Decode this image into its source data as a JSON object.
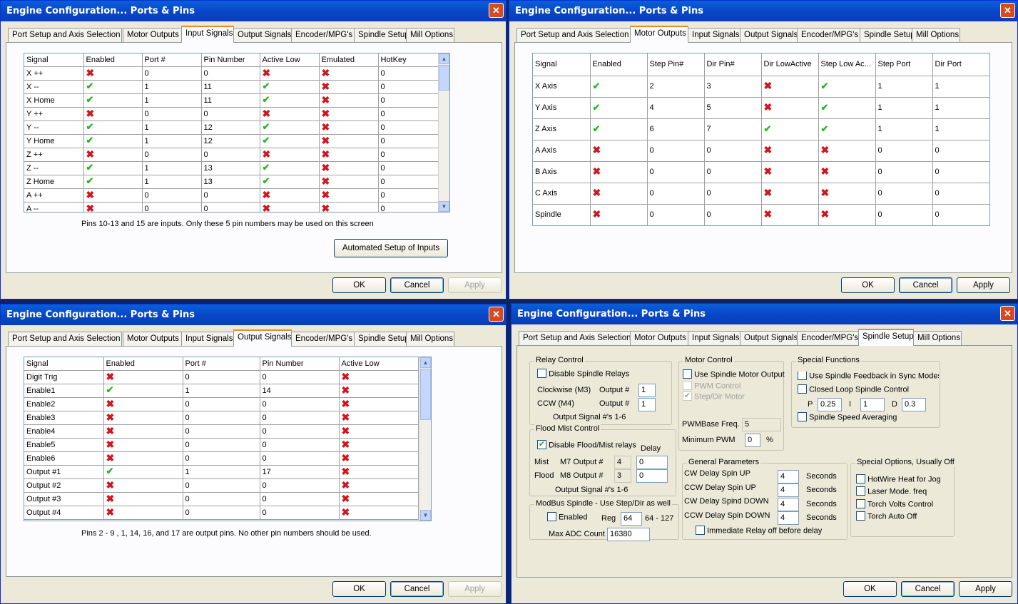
{
  "window_title": "Engine Configuration... Ports & Pins",
  "tabs": [
    "Port Setup and Axis Selection",
    "Motor Outputs",
    "Input Signals",
    "Output Signals",
    "Encoder/MPG's",
    "Spindle Setup",
    "Mill Options"
  ],
  "buttons": {
    "ok": "OK",
    "cancel": "Cancel",
    "apply": "Apply"
  },
  "close_glyph": "✕",
  "marks": {
    "yes": "✔",
    "no": "✖"
  },
  "input_signals": {
    "columns": [
      "Signal",
      "Enabled",
      "Port #",
      "Pin Number",
      "Active Low",
      "Emulated",
      "HotKey"
    ],
    "rows": [
      [
        "X ++",
        "no",
        "0",
        "0",
        "no",
        "no",
        "0"
      ],
      [
        "X --",
        "yes",
        "1",
        "11",
        "yes",
        "no",
        "0"
      ],
      [
        "X Home",
        "yes",
        "1",
        "11",
        "yes",
        "no",
        "0"
      ],
      [
        "Y ++",
        "no",
        "0",
        "0",
        "no",
        "no",
        "0"
      ],
      [
        "Y --",
        "yes",
        "1",
        "12",
        "yes",
        "no",
        "0"
      ],
      [
        "Y Home",
        "yes",
        "1",
        "12",
        "yes",
        "no",
        "0"
      ],
      [
        "Z ++",
        "no",
        "0",
        "0",
        "no",
        "no",
        "0"
      ],
      [
        "Z --",
        "yes",
        "1",
        "13",
        "yes",
        "no",
        "0"
      ],
      [
        "Z Home",
        "yes",
        "1",
        "13",
        "yes",
        "no",
        "0"
      ],
      [
        "A ++",
        "no",
        "0",
        "0",
        "no",
        "no",
        "0"
      ],
      [
        "A --",
        "no",
        "0",
        "0",
        "no",
        "no",
        "0"
      ]
    ],
    "note": "Pins 10-13 and 15 are inputs. Only these 5 pin numbers may be used on this screen",
    "automated_button": "Automated Setup of Inputs"
  },
  "motor_outputs": {
    "columns": [
      "Signal",
      "Enabled",
      "Step Pin#",
      "Dir Pin#",
      "Dir LowActive",
      "Step Low Ac...",
      "Step Port",
      "Dir Port"
    ],
    "rows": [
      [
        "X Axis",
        "yes",
        "2",
        "3",
        "no",
        "yes",
        "1",
        "1"
      ],
      [
        "Y Axis",
        "yes",
        "4",
        "5",
        "no",
        "yes",
        "1",
        "1"
      ],
      [
        "Z Axis",
        "yes",
        "6",
        "7",
        "yes",
        "yes",
        "1",
        "1"
      ],
      [
        "A Axis",
        "no",
        "0",
        "0",
        "no",
        "no",
        "0",
        "0"
      ],
      [
        "B Axis",
        "no",
        "0",
        "0",
        "no",
        "no",
        "0",
        "0"
      ],
      [
        "C Axis",
        "no",
        "0",
        "0",
        "no",
        "no",
        "0",
        "0"
      ],
      [
        "Spindle",
        "no",
        "0",
        "0",
        "no",
        "no",
        "0",
        "0"
      ]
    ]
  },
  "output_signals": {
    "columns": [
      "Signal",
      "Enabled",
      "Port #",
      "Pin Number",
      "Active Low"
    ],
    "rows": [
      [
        "Digit  Trig",
        "no",
        "0",
        "0",
        "no"
      ],
      [
        "Enable1",
        "yes",
        "1",
        "14",
        "no"
      ],
      [
        "Enable2",
        "no",
        "0",
        "0",
        "no"
      ],
      [
        "Enable3",
        "no",
        "0",
        "0",
        "no"
      ],
      [
        "Enable4",
        "no",
        "0",
        "0",
        "no"
      ],
      [
        "Enable5",
        "no",
        "0",
        "0",
        "no"
      ],
      [
        "Enable6",
        "no",
        "0",
        "0",
        "no"
      ],
      [
        "Output #1",
        "yes",
        "1",
        "17",
        "no"
      ],
      [
        "Output #2",
        "no",
        "0",
        "0",
        "no"
      ],
      [
        "Output #3",
        "no",
        "0",
        "0",
        "no"
      ],
      [
        "Output #4",
        "no",
        "0",
        "0",
        "no"
      ]
    ],
    "note": "Pins 2 - 9 , 1, 14, 16, and 17 are output pins.  No  other pin numbers should be used."
  },
  "spindle": {
    "relay": {
      "title": "Relay Control",
      "disable": "Disable Spindle Relays",
      "cw_label": "Clockwise (M3)",
      "ccw_label": "CCW (M4)",
      "output_label": "Output #",
      "cw_value": "1",
      "ccw_value": "1",
      "footer": "Output Signal #'s 1-6"
    },
    "motor": {
      "title": "Motor Control",
      "use_motor": "Use Spindle Motor Output",
      "pwm": "PWM Control",
      "stepdir": "Step/Dir Motor",
      "pwm_base_label": "PWMBase Freq.",
      "pwm_base_value": "5",
      "min_pwm_label": "Minimum PWM",
      "min_pwm_value": "0",
      "pct": "%"
    },
    "special": {
      "title": "Special Functions",
      "feedback": "Use Spindle Feedback in Sync Modes",
      "closed_loop": "Closed Loop Spindle Control",
      "p_label": "P",
      "p_value": "0.25",
      "i_label": "I",
      "i_value": "1",
      "d_label": "D",
      "d_value": "0.3",
      "averaging": "Spindle Speed Averaging"
    },
    "flood": {
      "title": "Flood Mist Control",
      "disable": "Disable Flood/Mist relays",
      "delay": "Delay",
      "mist": "Mist",
      "flood": "Flood",
      "m7": "M7 Output #",
      "m8": "M8 Output #",
      "m7_value": "4",
      "m8_value": "3",
      "m7_delay": "0",
      "m8_delay": "0",
      "footer": "Output Signal #'s 1-6"
    },
    "modbus": {
      "title": "ModBus Spindle - Use Step/Dir as well",
      "enabled": "Enabled",
      "reg_label": "Reg",
      "reg_value": "64",
      "reg_range": "64 - 127",
      "adc_label": "Max ADC Count",
      "adc_value": "16380"
    },
    "general": {
      "title": "General Parameters",
      "seconds": "Seconds",
      "cw_up": "CW Delay Spin UP",
      "ccw_up": "CCW Delay Spin UP",
      "cw_down": "CW Delay Spind DOWN",
      "ccw_down": "CCW Delay Spin DOWN",
      "cw_up_value": "4",
      "ccw_up_value": "4",
      "cw_down_value": "4",
      "ccw_down_value": "4",
      "immediate": "Immediate Relay off before delay"
    },
    "options": {
      "title": "Special Options, Usually Off",
      "hotwire": "HotWire Heat for Jog",
      "laser": "Laser Mode. freq",
      "torch_volts": "Torch Volts Control",
      "torch_auto": "Torch Auto Off"
    }
  }
}
